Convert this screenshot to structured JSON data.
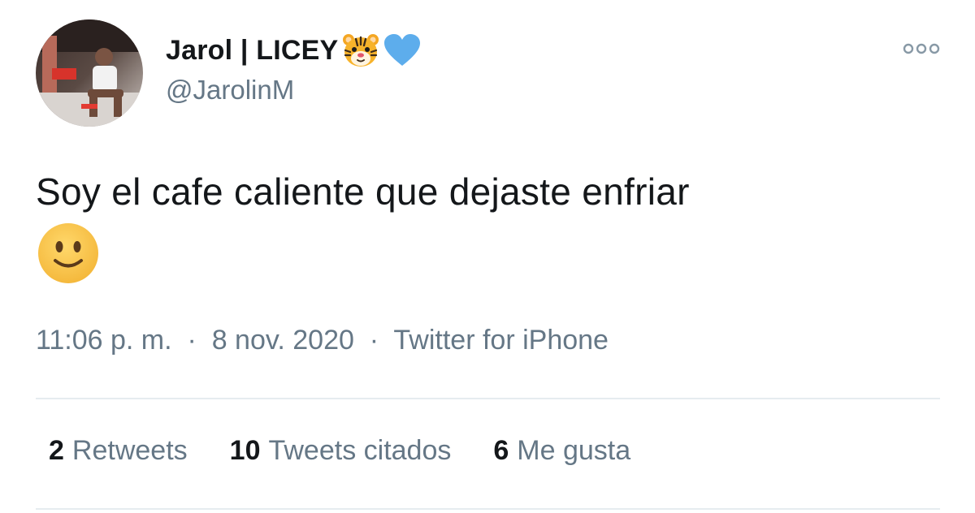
{
  "author": {
    "display_name": "Jarol | LICEY",
    "handle": "@JarolinM",
    "name_icons": [
      "tiger-face-icon",
      "blue-heart-icon"
    ]
  },
  "tweet": {
    "text": "Soy el cafe caliente que dejaste enfriar",
    "trailing_emoji": "slightly-smiling-face-icon"
  },
  "meta": {
    "time": "11:06 p. m.",
    "separator": "·",
    "date": "8 nov. 2020",
    "source": "Twitter for iPhone"
  },
  "stats": [
    {
      "count": "2",
      "label": "Retweets"
    },
    {
      "count": "10",
      "label": "Tweets citados"
    },
    {
      "count": "6",
      "label": "Me gusta"
    }
  ],
  "colors": {
    "text_primary": "#14171a",
    "text_secondary": "#657786",
    "divider": "#e6ecf0",
    "heart_blue": "#5dadec",
    "emoji_yellow": "#f7c948"
  }
}
